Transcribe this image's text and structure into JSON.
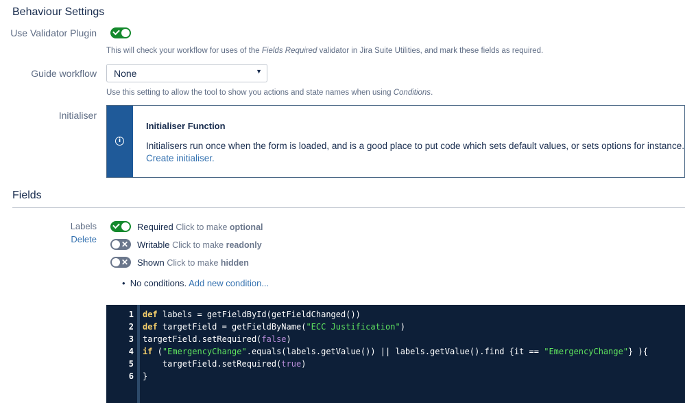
{
  "behaviour": {
    "title": "Behaviour Settings",
    "validator_label": "Use Validator Plugin",
    "validator_desc_1": "This will check your workflow for uses of the ",
    "validator_desc_em": "Fields Required",
    "validator_desc_2": " validator in Jira Suite Utilities, and mark these fields as required.",
    "guide_label": "Guide workflow",
    "guide_value": "None",
    "guide_desc_1": "Use this setting to allow the tool to show you actions and state names when using ",
    "guide_desc_em": "Conditions",
    "guide_desc_2": ".",
    "initialiser_label": "Initialiser",
    "panel_title": "Initialiser Function",
    "panel_text": "Initialisers run once when the form is loaded, and is a good place to put code which sets default values, or sets options for instance.",
    "panel_link": "Create initialiser."
  },
  "fields": {
    "title": "Fields",
    "field_name": "Labels",
    "delete_label": "Delete",
    "required_label": "Required",
    "required_hint": "Click to make ",
    "required_hint_b": "optional",
    "writable_label": "Writable",
    "writable_hint": "Click to make ",
    "writable_hint_b": "readonly",
    "shown_label": "Shown",
    "shown_hint": "Click to make ",
    "shown_hint_b": "hidden",
    "no_conditions": "No conditions.",
    "add_condition": "Add new condition..."
  },
  "code": {
    "line_numbers": [
      "1",
      "2",
      "3",
      "4",
      "5",
      "6"
    ],
    "l1_kw": "def",
    "l1_rest": " labels = getFieldById(getFieldChanged())",
    "l2_kw": "def",
    "l2_a": " targetField = getFieldByName(",
    "l2_str": "\"ECC Justification\"",
    "l2_b": ")",
    "l3_a": "targetField.setRequired(",
    "l3_bool": "false",
    "l3_b": ")",
    "l4_kw": "if",
    "l4_a": " (",
    "l4_str1": "\"EmergencyChange\"",
    "l4_b": ".equals(labels.getValue()) || labels.getValue().find {it == ",
    "l4_str2": "\"EmergencyChange\"",
    "l4_c": "} ){",
    "l5_a": "    targetField.setRequired(",
    "l5_bool": "true",
    "l5_b": ")",
    "l6": "}"
  }
}
